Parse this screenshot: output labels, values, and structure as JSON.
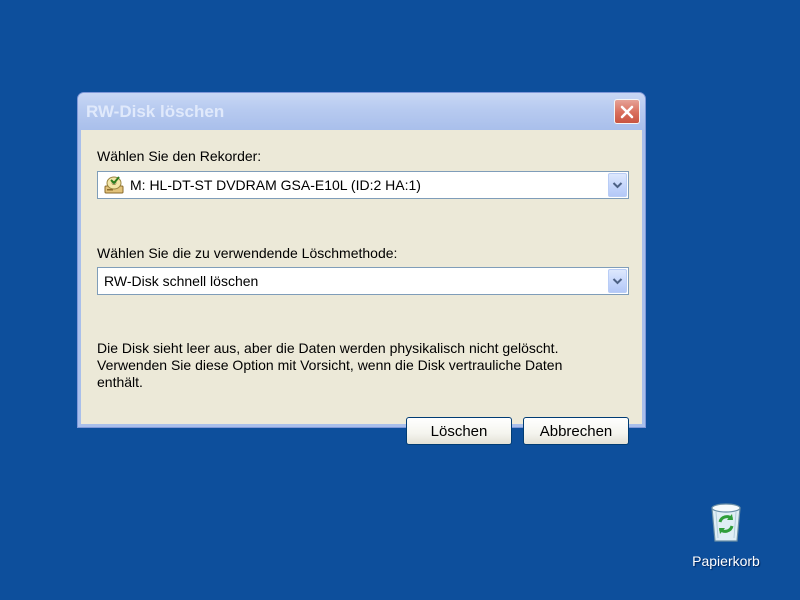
{
  "dialog": {
    "title": "RW-Disk löschen",
    "close_icon": "close-icon",
    "recorder_label": "Wählen Sie den Rekorder:",
    "recorder_value": "M: HL-DT-ST DVDRAM GSA-E10L  (ID:2 HA:1)",
    "recorder_icon": "optical-drive-icon",
    "method_label": "Wählen Sie die zu verwendende Löschmethode:",
    "method_value": "RW-Disk schnell löschen",
    "description": [
      "Die Disk sieht leer aus, aber die Daten werden physikalisch nicht gelöscht.",
      "Verwenden Sie diese Option mit Vorsicht, wenn die Disk vertrauliche Daten",
      "enthält."
    ],
    "erase_button": "Löschen",
    "cancel_button": "Abbrechen"
  },
  "desktop": {
    "recycle_bin_label": "Papierkorb",
    "recycle_bin_icon": "recycle-bin-icon"
  },
  "colors": {
    "desktop_background": "#0d4f9c",
    "dialog_face": "#ece9d8",
    "close_button": "#d96e5c"
  }
}
